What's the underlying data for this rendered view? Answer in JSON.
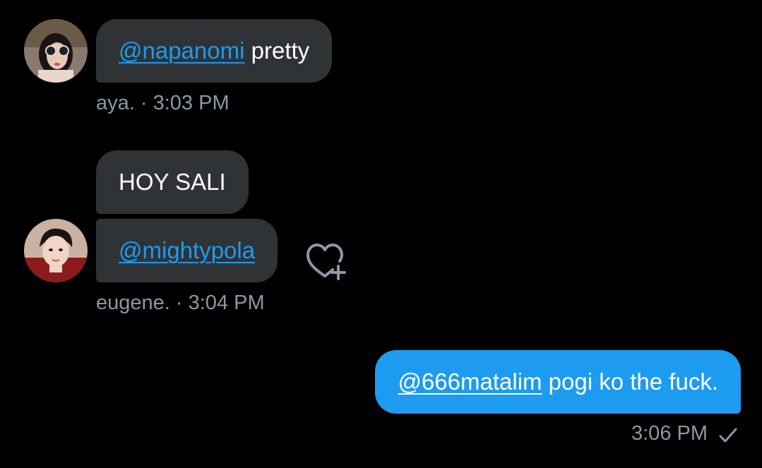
{
  "messages": [
    {
      "mention": "@napanomi",
      "text": " pretty",
      "sender": "aya.",
      "separator": " · ",
      "time": "3:03 PM"
    },
    {
      "text": "HOY SALI"
    },
    {
      "mention": "@mightypola",
      "sender": "eugene.",
      "separator": " · ",
      "time": "3:04 PM"
    },
    {
      "mention": "@666matalim",
      "text": " pogi ko the fuck.",
      "time": "3:06 PM"
    }
  ],
  "icons": {
    "react": "heart-add-icon",
    "sent_status": "checkmark-icon"
  },
  "colors": {
    "background": "#000000",
    "received_bubble": "#2f3336",
    "sent_bubble": "#1d9bf0",
    "mention": "#1d9bf0",
    "meta_text": "#8b98a5"
  }
}
